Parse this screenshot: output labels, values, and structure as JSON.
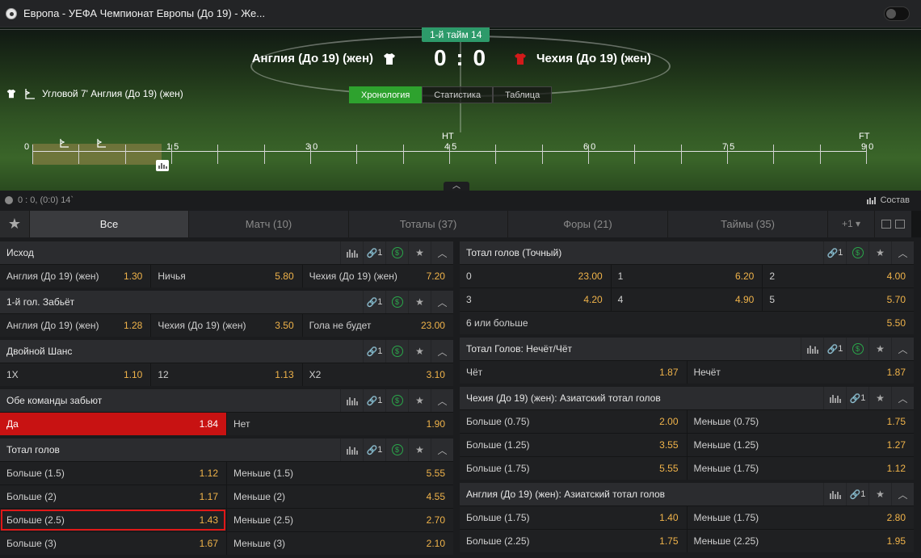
{
  "header": {
    "title": "Европа - УЕФА Чемпионат Европы (До 19) - Же..."
  },
  "match": {
    "period": "1-й тайм 14",
    "home": "Англия (До 19) (жен)",
    "away": "Чехия (До 19) (жен)",
    "score": "0 : 0",
    "last_event": "Угловой 7' Англия (До 19) (жен)",
    "tabs": [
      "Хронология",
      "Статистика",
      "Таблица"
    ],
    "active_tab": "Хронология"
  },
  "timeline": {
    "ticks": [
      "0",
      "1 5",
      "3 0",
      "4 5",
      "6 0",
      "7 5",
      "9 0"
    ],
    "upper": [
      "HT",
      "FT"
    ],
    "elapsed_minute": 14
  },
  "info": {
    "status": "0 : 0, (0:0) 14`",
    "lineup": "Состав"
  },
  "market_nav": {
    "tabs": [
      "Все",
      "Матч (10)",
      "Тоталы (37)",
      "Форы (21)",
      "Таймы (35)"
    ],
    "active": "Все",
    "more": "+1"
  },
  "icons": {
    "link_count": "1"
  },
  "left_markets": [
    {
      "title": "Исход",
      "rows": [
        [
          [
            "Англия (До 19) (жен)",
            "1.30"
          ],
          [
            "Ничья",
            "5.80"
          ],
          [
            "Чехия (До 19) (жен)",
            "7.20"
          ]
        ]
      ]
    },
    {
      "title": "1-й гол. Забьёт",
      "rows": [
        [
          [
            "Англия (До 19) (жен)",
            "1.28"
          ],
          [
            "Чехия (До 19) (жен)",
            "3.50"
          ],
          [
            "Гола не будет",
            "23.00"
          ]
        ]
      ]
    },
    {
      "title": "Двойной Шанс",
      "rows": [
        [
          [
            "1X",
            "1.10"
          ],
          [
            "12",
            "1.13"
          ],
          [
            "X2",
            "3.10"
          ]
        ]
      ]
    },
    {
      "title": "Обе команды забьют",
      "rows": [
        [
          [
            "Да",
            "1.84"
          ],
          [
            "Нет",
            "1.90"
          ]
        ]
      ]
    },
    {
      "title": "Тотал голов",
      "rows": [
        [
          [
            "Больше (1.5)",
            "1.12"
          ],
          [
            "Меньше (1.5)",
            "5.55"
          ]
        ],
        [
          [
            "Больше (2)",
            "1.17"
          ],
          [
            "Меньше (2)",
            "4.55"
          ]
        ],
        [
          [
            "Больше (2.5)",
            "1.43"
          ],
          [
            "Меньше (2.5)",
            "2.70"
          ]
        ],
        [
          [
            "Больше (3)",
            "1.67"
          ],
          [
            "Меньше (3)",
            "2.10"
          ]
        ]
      ]
    }
  ],
  "right_markets": [
    {
      "title": "Тотал голов (Точный)",
      "rows": [
        [
          [
            "0",
            "23.00"
          ],
          [
            "1",
            "6.20"
          ],
          [
            "2",
            "4.00"
          ]
        ],
        [
          [
            "3",
            "4.20"
          ],
          [
            "4",
            "4.90"
          ],
          [
            "5",
            "5.70"
          ]
        ],
        [
          [
            "6 или больше",
            "5.50"
          ]
        ]
      ]
    },
    {
      "title": "Тотал Голов: Нечёт/Чёт",
      "rows": [
        [
          [
            "Чёт",
            "1.87"
          ],
          [
            "Нечёт",
            "1.87"
          ]
        ]
      ]
    },
    {
      "title": "Чехия (До 19) (жен): Азиатский тотал голов",
      "rows": [
        [
          [
            "Больше (0.75)",
            "2.00"
          ],
          [
            "Меньше (0.75)",
            "1.75"
          ]
        ],
        [
          [
            "Больше (1.25)",
            "3.55"
          ],
          [
            "Меньше (1.25)",
            "1.27"
          ]
        ],
        [
          [
            "Больше (1.75)",
            "5.55"
          ],
          [
            "Меньше (1.75)",
            "1.12"
          ]
        ]
      ]
    },
    {
      "title": "Англия (До 19) (жен): Азиатский тотал голов",
      "rows": [
        [
          [
            "Больше (1.75)",
            "1.40"
          ],
          [
            "Меньше (1.75)",
            "2.80"
          ]
        ],
        [
          [
            "Больше (2.25)",
            "1.75"
          ],
          [
            "Меньше (2.25)",
            "1.95"
          ]
        ]
      ]
    }
  ]
}
